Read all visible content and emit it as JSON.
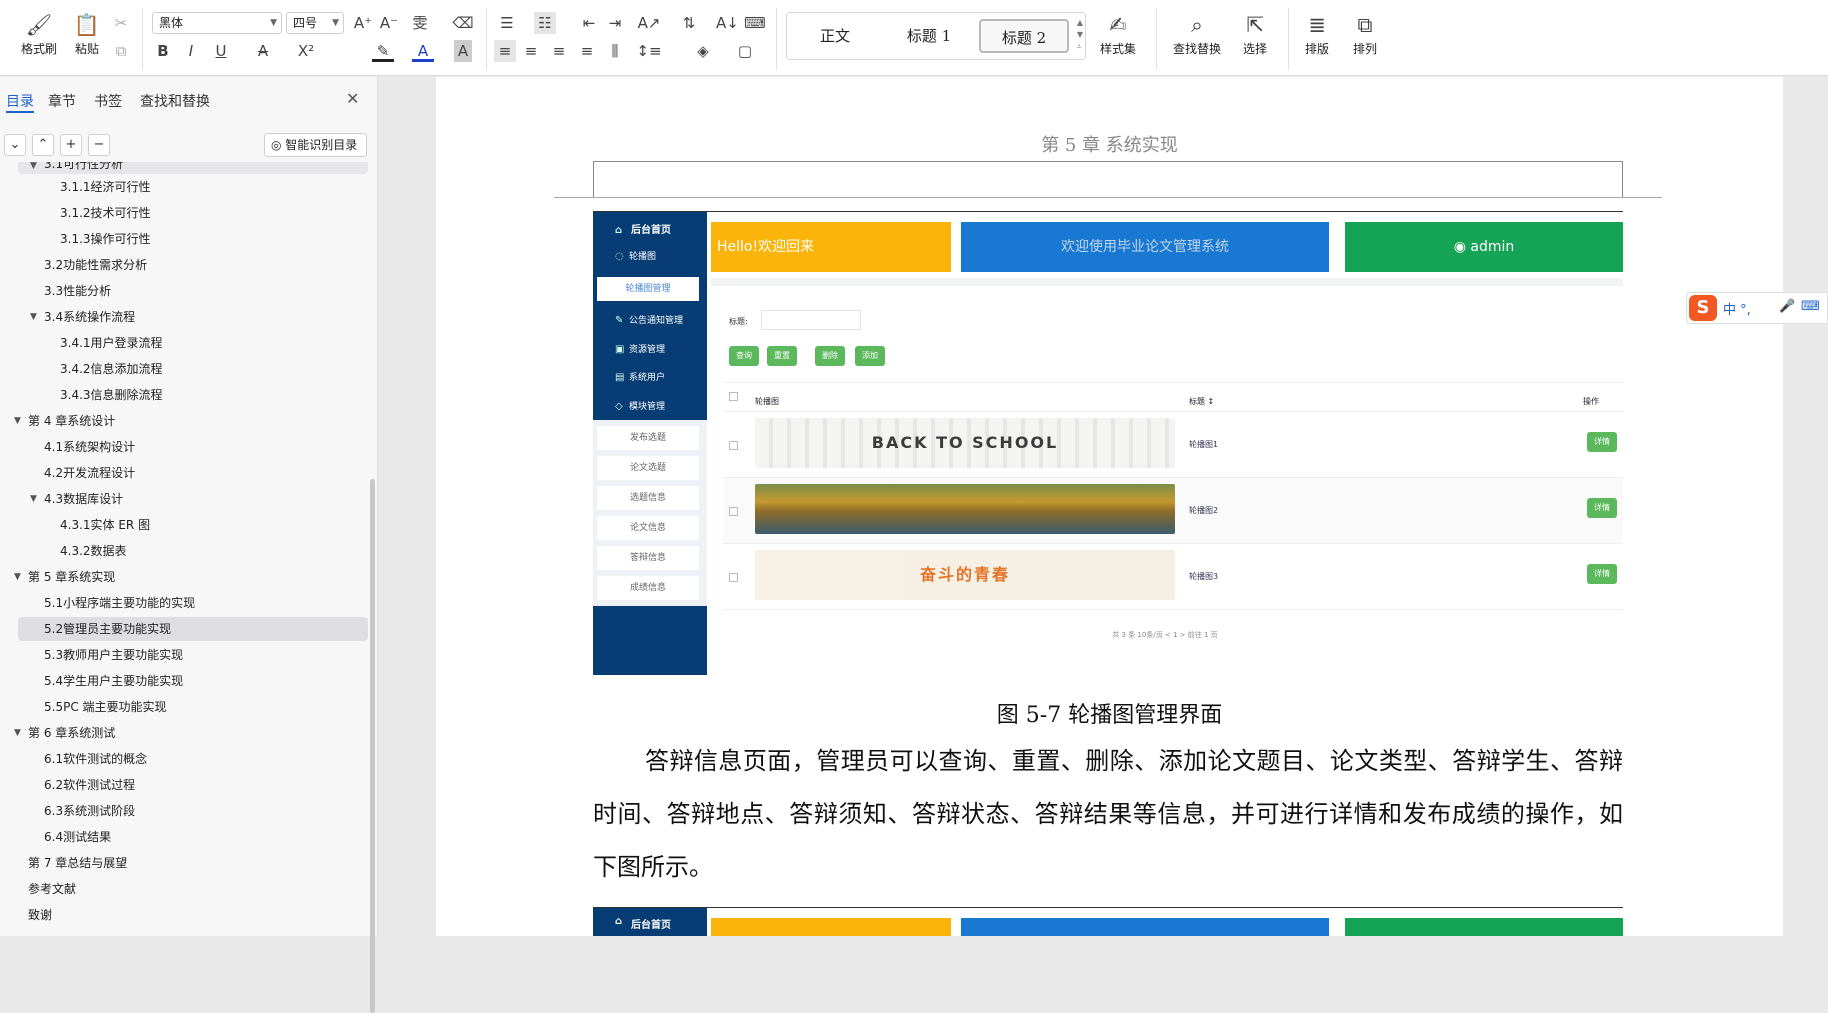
{
  "ribbon": {
    "format_painter": "格式刷",
    "paste": "粘贴",
    "font_name": "黑体",
    "font_size": "四号",
    "bold": "B",
    "italic": "I",
    "underline": "U",
    "strike": "A",
    "superscript": "X²",
    "styles": [
      "正文",
      "标题 1",
      "标题 2"
    ],
    "style_set": "样式集",
    "find_replace": "查找替换",
    "select": "选择",
    "typeset": "排版",
    "arrange": "排列"
  },
  "panel": {
    "tabs": [
      "目录",
      "章节",
      "书签",
      "查找和替换"
    ],
    "smart_toc": "智能识别目录",
    "toc": [
      {
        "text": "3.1可行性分析",
        "level": 2,
        "tri": true,
        "selected": false,
        "clipped": true
      },
      {
        "text": "3.1.1经济可行性",
        "level": 3
      },
      {
        "text": "3.1.2技术可行性",
        "level": 3
      },
      {
        "text": "3.1.3操作可行性",
        "level": 3
      },
      {
        "text": "3.2功能性需求分析",
        "level": 2
      },
      {
        "text": "3.3性能分析",
        "level": 2
      },
      {
        "text": "3.4系统操作流程",
        "level": 2,
        "tri": true
      },
      {
        "text": "3.4.1用户登录流程",
        "level": 3
      },
      {
        "text": "3.4.2信息添加流程",
        "level": 3
      },
      {
        "text": "3.4.3信息删除流程",
        "level": 3
      },
      {
        "text": "第 4 章系统设计",
        "level": 1,
        "tri": true
      },
      {
        "text": "4.1系统架构设计",
        "level": 2
      },
      {
        "text": "4.2开发流程设计",
        "level": 2
      },
      {
        "text": "4.3数据库设计",
        "level": 2,
        "tri": true
      },
      {
        "text": "4.3.1实体 ER 图",
        "level": 3
      },
      {
        "text": "4.3.2数据表",
        "level": 3
      },
      {
        "text": "第 5 章系统实现",
        "level": 1,
        "tri": true
      },
      {
        "text": "5.1小程序端主要功能的实现",
        "level": 2
      },
      {
        "text": "5.2管理员主要功能实现",
        "level": 2,
        "selected": true
      },
      {
        "text": "5.3教师用户主要功能实现",
        "level": 2
      },
      {
        "text": "5.4学生用户主要功能实现",
        "level": 2
      },
      {
        "text": "5.5PC 端主要功能实现",
        "level": 2
      },
      {
        "text": "第 6 章系统测试",
        "level": 1,
        "tri": true
      },
      {
        "text": "6.1软件测试的概念",
        "level": 2
      },
      {
        "text": "6.2软件测试过程",
        "level": 2
      },
      {
        "text": "6.3系统测试阶段",
        "level": 2
      },
      {
        "text": "6.4测试结果",
        "level": 2
      },
      {
        "text": "第 7 章总结与展望",
        "level": 1
      },
      {
        "text": "参考文献",
        "level": 1
      },
      {
        "text": "致谢",
        "level": 1
      }
    ]
  },
  "doc": {
    "header": "第 5 章  系统实现",
    "caption": "图 5-7 轮播图管理界面",
    "paragraph": "答辩信息页面，管理员可以查询、重置、删除、添加论文题目、论文类型、答辩学生、答辩时间、答辩地点、答辩须知、答辩状态、答辩结果等信息，并可进行详情和发布成绩的操作，如下图所示。"
  },
  "screenshot": {
    "sidebar_home": "后台首页",
    "sidebar_items": [
      "轮播图",
      "轮播图管理",
      "公告通知管理",
      "资源管理",
      "系统用户",
      "模块管理",
      "发布选题",
      "论文选题",
      "选题信息",
      "论文信息",
      "答辩信息",
      "成绩信息"
    ],
    "card1": "Hello!欢迎回来",
    "card2": "欢迎使用毕业论文管理系统",
    "card3": "admin",
    "filter_label": "标题:",
    "buttons": [
      "查询",
      "重置",
      "删除",
      "添加"
    ],
    "col_image": "轮播图",
    "col_title": "标题 ↕",
    "col_action": "操作",
    "rows": [
      {
        "title": "轮播图1",
        "banner": "BACK TO SCHOOL"
      },
      {
        "title": "轮播图2",
        "banner": ""
      },
      {
        "title": "轮播图3",
        "banner": "奋斗的青春"
      }
    ],
    "detail": "详情",
    "pager": "共 3 条    10条/页    <  1  >   前往  1  页"
  },
  "ime": {
    "label": "中 °, "
  }
}
